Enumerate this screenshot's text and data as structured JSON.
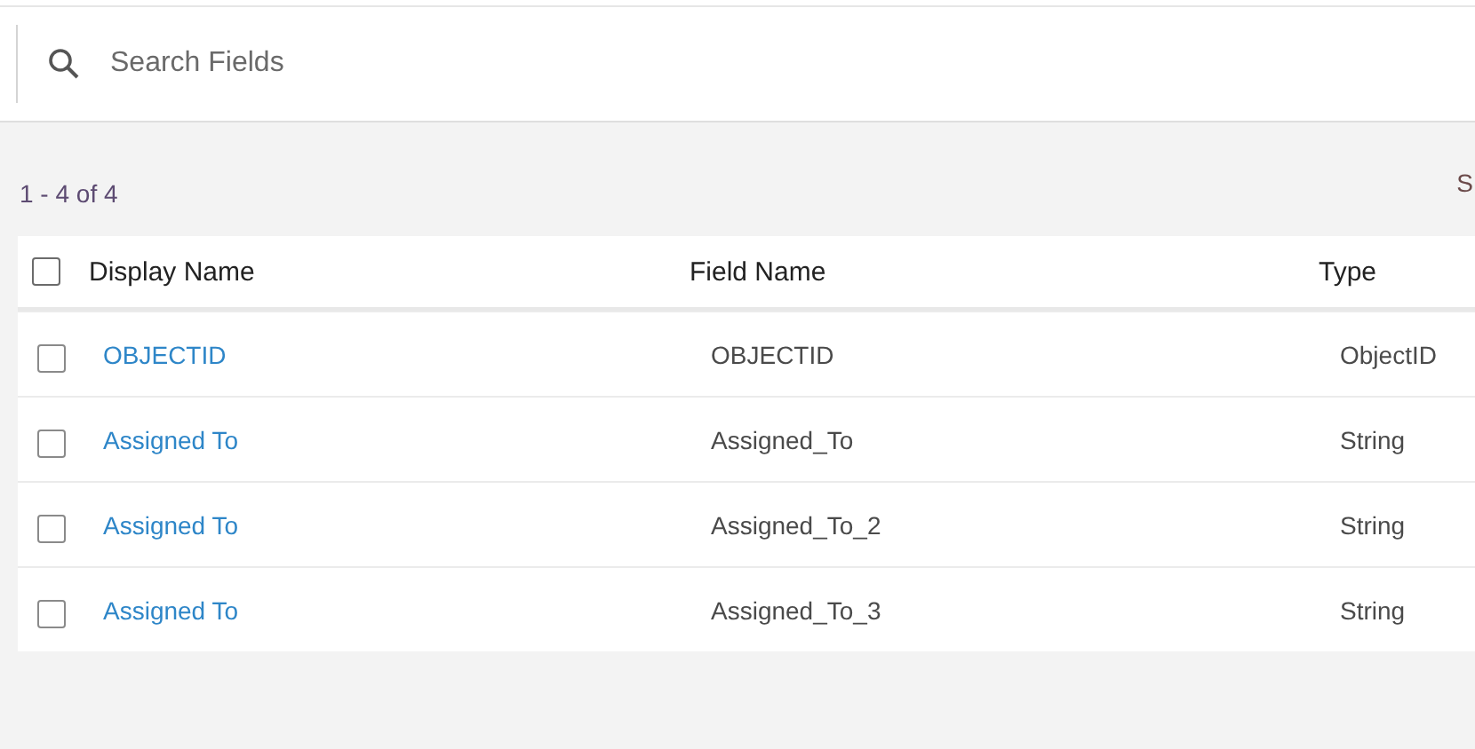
{
  "search": {
    "placeholder": "Search Fields"
  },
  "result_count": "1 - 4 of 4",
  "edge_text": "S",
  "table": {
    "select_all": {
      "checked": false
    },
    "columns": [
      "Display Name",
      "Field Name",
      "Type"
    ],
    "rows": [
      {
        "checked": false,
        "display_name": "OBJECTID",
        "field_name": "OBJECTID",
        "type": "ObjectID"
      },
      {
        "checked": false,
        "display_name": "Assigned To",
        "field_name": "Assigned_To",
        "type": "String"
      },
      {
        "checked": false,
        "display_name": "Assigned To",
        "field_name": "Assigned_To_2",
        "type": "String"
      },
      {
        "checked": false,
        "display_name": "Assigned To",
        "field_name": "Assigned_To_3",
        "type": "String"
      }
    ]
  }
}
